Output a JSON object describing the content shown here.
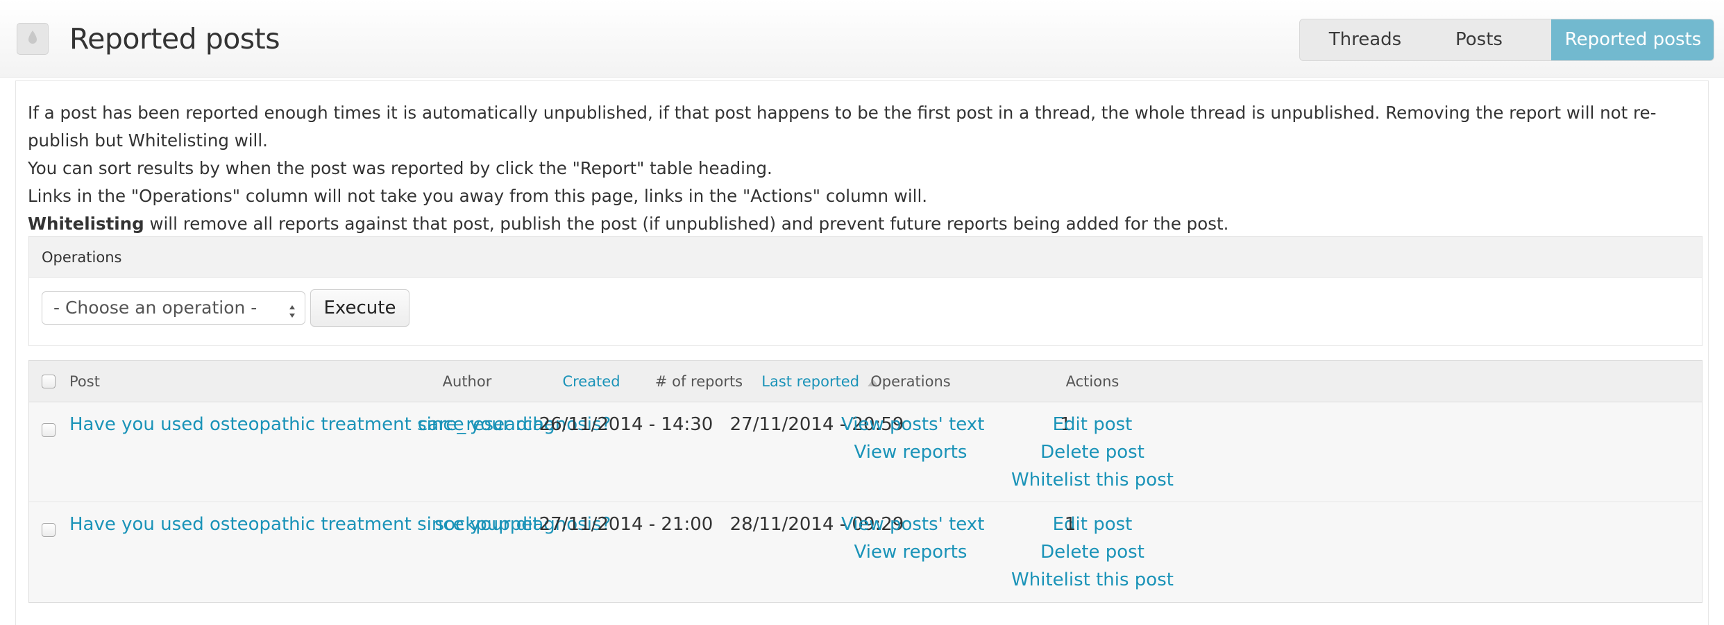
{
  "header": {
    "title": "Reported posts",
    "icon": "drop-icon",
    "tabs": [
      {
        "label": "Threads",
        "active": false
      },
      {
        "label": "Posts",
        "active": false
      },
      {
        "label": "Reported posts",
        "active": true
      }
    ]
  },
  "intro": {
    "line1": "If a post has been reported enough times it is automatically unpublished, if that post happens to be the first post in a thread, the whole thread is unpublished. Removing the report will not re-publish but Whitelisting will.",
    "line2": "You can sort results by when the post was reported by click the \"Report\" table heading.",
    "line3": "Links in the \"Operations\" column will not take you away from this page, links in the \"Actions\" column will.",
    "line4_bold": "Whitelisting",
    "line4_rest": " will remove all reports against that post, publish the post (if unpublished) and prevent future reports being added for the post."
  },
  "operations": {
    "heading": "Operations",
    "select_value": "- Choose an operation -",
    "execute_label": "Execute"
  },
  "table": {
    "headers": {
      "post": "Post",
      "author": "Author",
      "created": "Created",
      "reports": "# of reports",
      "last_reported": "Last reported",
      "operations": "Operations",
      "actions": "Actions"
    },
    "rows": [
      {
        "post": "Have you used osteopathic treatment since your diagnosis?",
        "author": "care_researcher",
        "created": "26/11/2014 - 14:30",
        "reports": "1",
        "last_reported": "27/11/2014 - 20:59",
        "op1": "View posts' text",
        "op2": "View reports",
        "act1": "Edit post",
        "act2": "Delete post",
        "act3": "Whitelist this post"
      },
      {
        "post": "Have you used osteopathic treatment since your diagnosis?",
        "author": "sockpuppet",
        "created": "27/11/2014 - 21:00",
        "reports": "1",
        "last_reported": "28/11/2014 - 09:29",
        "op1": "View posts' text",
        "op2": "View reports",
        "act1": "Edit post",
        "act2": "Delete post",
        "act3": "Whitelist this post"
      }
    ]
  },
  "colors": {
    "accent": "#72b9cf",
    "link": "#1a93b8"
  }
}
